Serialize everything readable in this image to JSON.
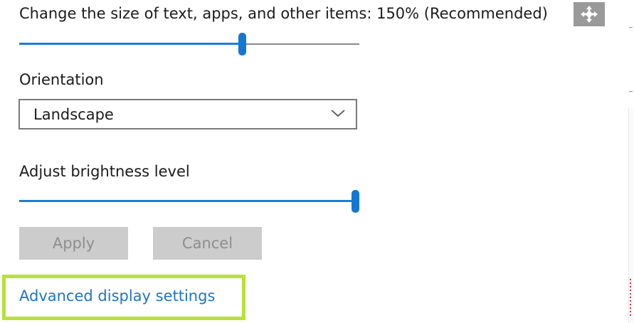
{
  "scale": {
    "label": "Change the size of text, apps, and other items: 150% (Recommended)",
    "level_percent": 66
  },
  "orientation": {
    "label": "Orientation",
    "selected": "Landscape"
  },
  "brightness": {
    "label": "Adjust brightness level",
    "level_percent": 100
  },
  "buttons": {
    "apply": "Apply",
    "cancel": "Cancel"
  },
  "links": {
    "advanced": "Advanced display settings"
  },
  "icons": {
    "move": "move-arrows-icon",
    "dropdown": "chevron-down-icon"
  },
  "colors": {
    "accent": "#1a7fd4",
    "link": "#1c75c6",
    "highlight": "#b6e23a",
    "button_disabled_bg": "#cccccc"
  }
}
